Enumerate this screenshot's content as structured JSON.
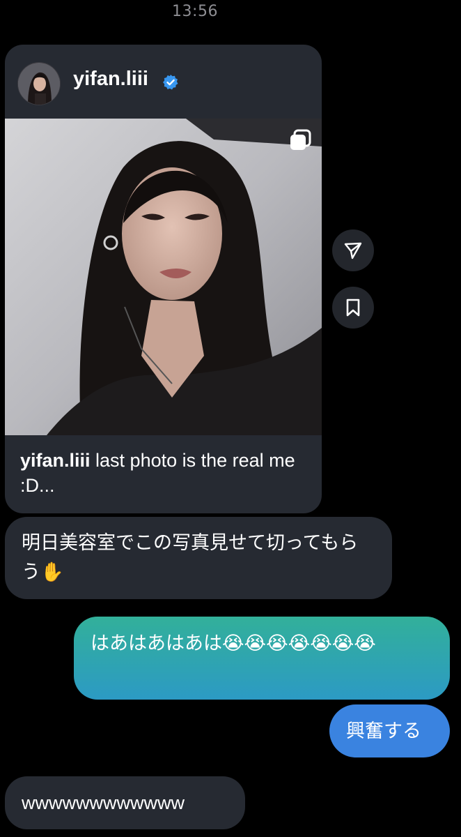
{
  "status_bar": {
    "time": "13:56"
  },
  "shared_post": {
    "username": "yifan.liii",
    "verified_icon": "verified-badge-icon",
    "carousel_icon": "multiple-images-icon",
    "caption_username": "yifan.liii",
    "caption_text": " last photo is the real me :D..."
  },
  "side_actions": {
    "share_icon": "send-icon",
    "save_icon": "bookmark-icon"
  },
  "messages": [
    {
      "direction": "incoming",
      "text": "明日美容室でこの写真見せて切ってもらう✋"
    },
    {
      "direction": "outgoing",
      "text": "はあはあはあは😭😭😭😭😭😭😭"
    },
    {
      "direction": "outgoing",
      "text": "興奮する"
    },
    {
      "direction": "incoming",
      "text": "wwwwwwwwwwww"
    }
  ],
  "colors": {
    "background": "#000000",
    "incoming_bubble": "#262a32",
    "outgoing_gradient_top": "#32b09a",
    "outgoing_gradient_bottom": "#2c9ac4",
    "outgoing_solid": "#3a83e0",
    "verified_blue": "#3897f0"
  }
}
